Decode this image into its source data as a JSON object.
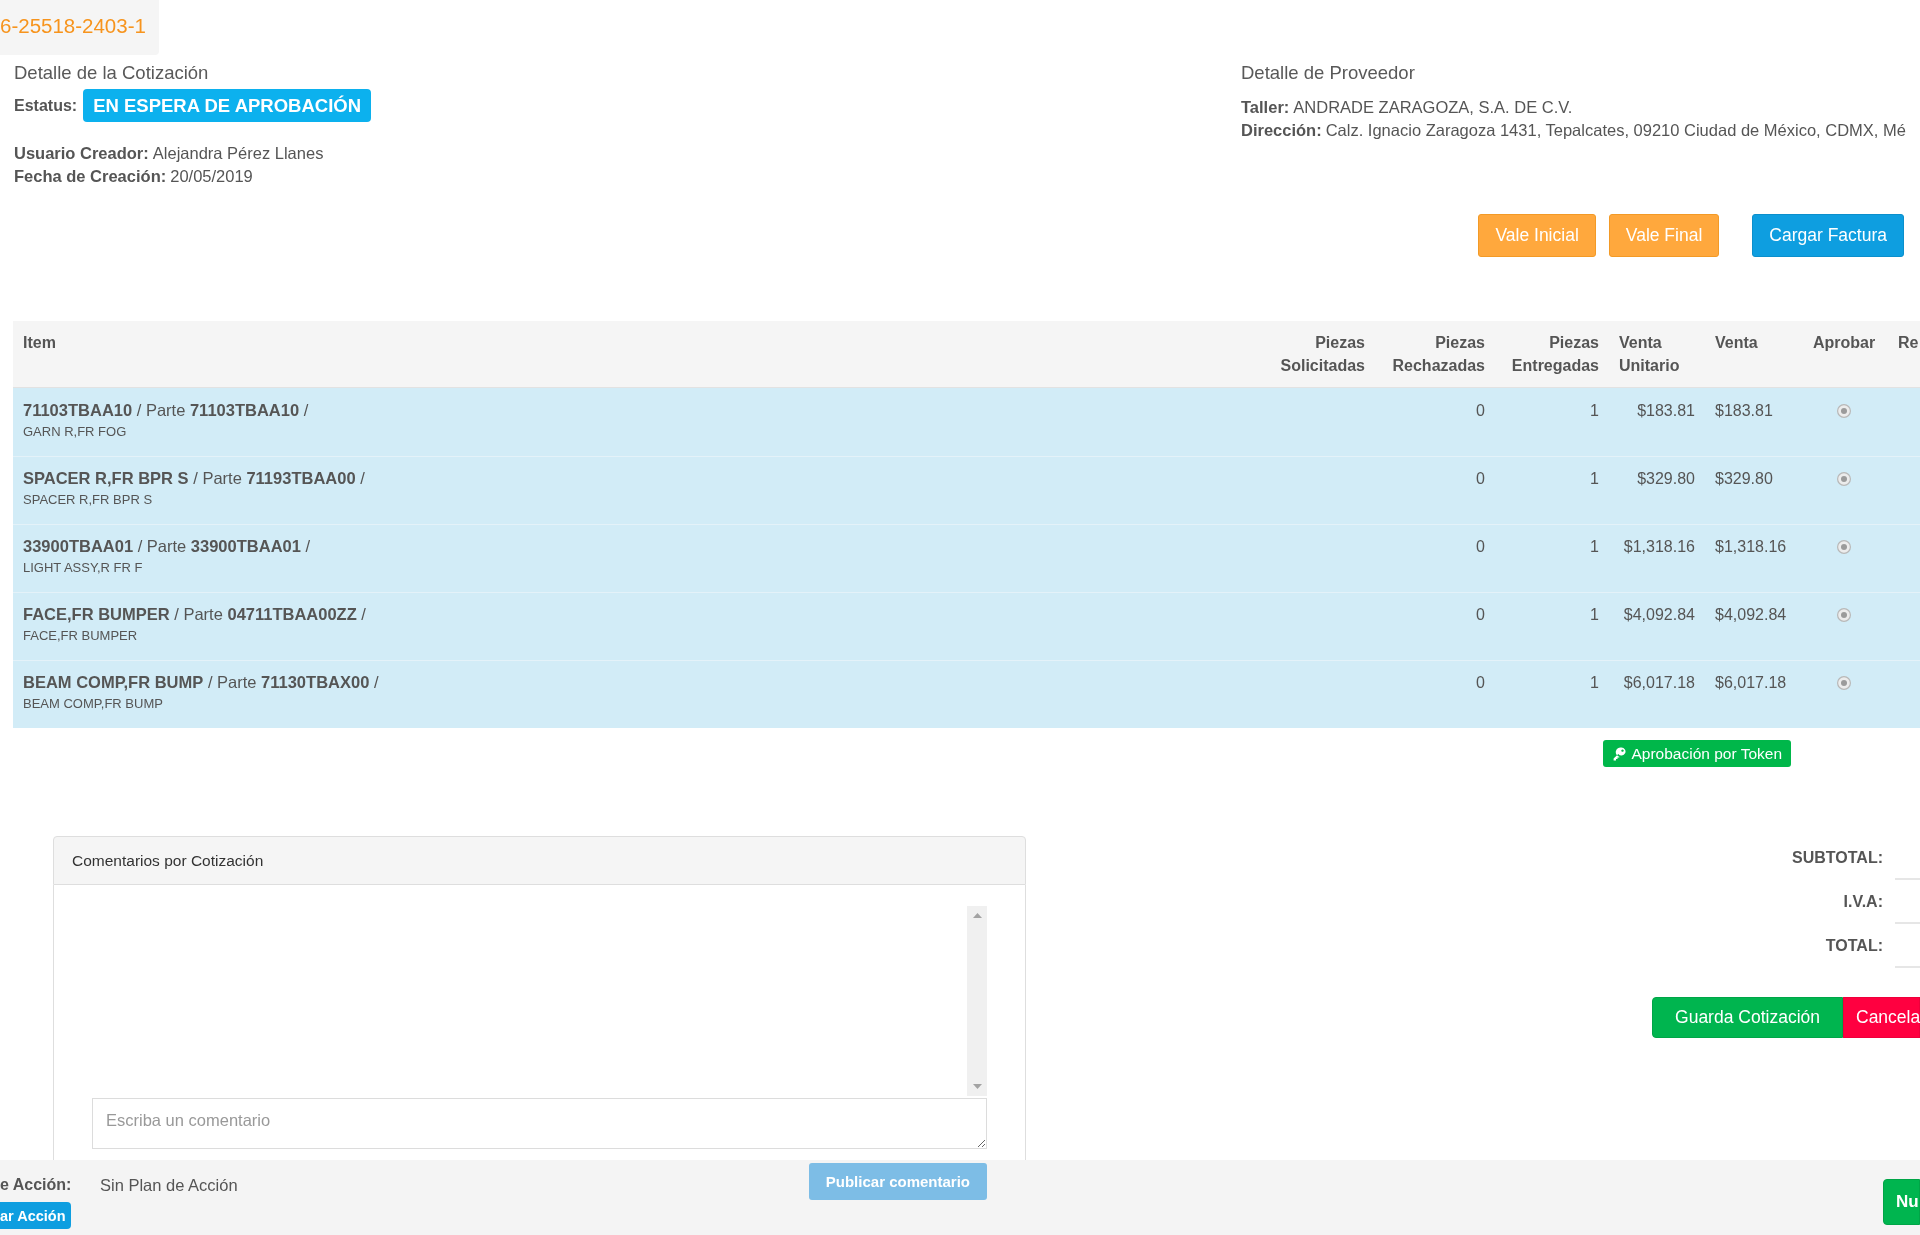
{
  "header": {
    "quote_number": "6-25518-2403-1"
  },
  "quote_detail": {
    "title": "Detalle de la Cotización",
    "status_label": "Estatus:",
    "status": "EN ESPERA DE APROBACIÓN",
    "fields": [
      {
        "label": "Usuario Creador:",
        "value": "Alejandra Pérez Llanes"
      },
      {
        "label": "Fecha de Creación:",
        "value": "20/05/2019"
      }
    ]
  },
  "supplier_detail": {
    "title": "Detalle de Proveedor",
    "fields": [
      {
        "label": "Taller:",
        "value": "ANDRADE ZARAGOZA, S.A. DE C.V."
      },
      {
        "label": "Dirección:",
        "value": "Calz. Ignacio Zaragoza 1431, Tepalcates, 09210 Ciudad de México, CDMX, Mé"
      }
    ]
  },
  "actions": [
    {
      "label": "Vale Inicial",
      "kind": "warning"
    },
    {
      "label": "Vale Final",
      "kind": "warning"
    },
    {
      "label": "Cargar Factura",
      "kind": "primary"
    }
  ],
  "table": {
    "columns": [
      "Item",
      "Piezas Solicitadas",
      "Piezas Rechazadas",
      "Piezas Entregadas",
      "Venta Unitario",
      "Venta",
      "Aprobar",
      "Re"
    ],
    "rows": [
      {
        "item": "**71103TBAA10** / Parte **71103TBAA10** /",
        "description": "GARN R,FR FOG",
        "rejected": "0",
        "delivered": "1",
        "unit_price": "$183.81",
        "price": "$183.81",
        "approved": true
      },
      {
        "item": "**SPACER R,FR BPR S** / Parte **71193TBAA00** /",
        "description": "SPACER R,FR BPR S",
        "rejected": "0",
        "delivered": "1",
        "unit_price": "$329.80",
        "price": "$329.80",
        "approved": true
      },
      {
        "item": "**33900TBAA01** / Parte **33900TBAA01** /",
        "description": "LIGHT ASSY,R FR F",
        "rejected": "0",
        "delivered": "1",
        "unit_price": "$1,318.16",
        "price": "$1,318.16",
        "approved": true
      },
      {
        "item": "**FACE,FR BUMPER** / Parte **04711TBAA00ZZ** /",
        "description": "FACE,FR BUMPER",
        "rejected": "0",
        "delivered": "1",
        "unit_price": "$4,092.84",
        "price": "$4,092.84",
        "approved": true
      },
      {
        "item": "**BEAM COMP,FR BUMP** / Parte **71130TBAX00** /",
        "description": "BEAM COMP,FR BUMP",
        "rejected": "0",
        "delivered": "1",
        "unit_price": "$6,017.18",
        "price": "$6,017.18",
        "approved": true
      }
    ]
  },
  "token_button": {
    "label": "Aprobación por Token"
  },
  "comments": {
    "title": "Comentarios por Cotización",
    "placeholder": "Escriba un comentario",
    "submit": {
      "label": "Publicar comentario",
      "disabled": true
    }
  },
  "totals": {
    "rows": [
      {
        "label": "SUBTOTAL:"
      },
      {
        "label": "I.V.A:"
      },
      {
        "label": "TOTAL:"
      }
    ],
    "buttons": [
      {
        "label": "Guarda Cotización",
        "kind": "success"
      },
      {
        "label": "Cancela",
        "kind": "danger"
      }
    ]
  },
  "footer": {
    "plan_label": "e Acción:",
    "plan_value": "Sin Plan de Acción",
    "plan_button": "ar Acción",
    "new_button": "Nu"
  }
}
